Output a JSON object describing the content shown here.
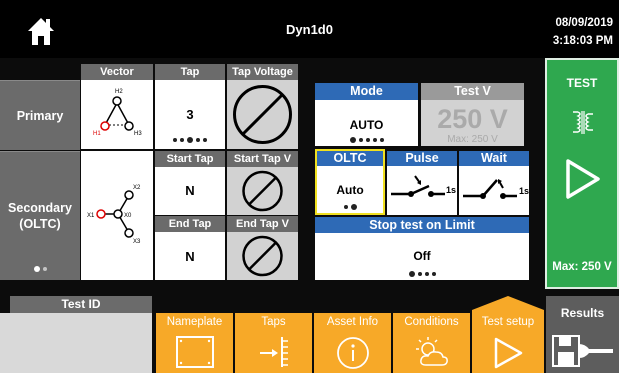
{
  "header": {
    "title": "Dyn1d0",
    "date": "08/09/2019",
    "time": "3:18:03 PM"
  },
  "rows": {
    "primary": "Primary",
    "secondary_line1": "Secondary",
    "secondary_line2": "(OLTC)"
  },
  "columns": {
    "vector": "Vector",
    "tap": "Tap",
    "tap_voltage": "Tap Voltage",
    "start_tap": "Start Tap",
    "start_tap_v": "Start Tap V",
    "end_tap": "End Tap",
    "end_tap_v": "End Tap V"
  },
  "primary": {
    "tap_value": "3",
    "vector_labels": {
      "top": "H2",
      "left": "H1",
      "right": "H3"
    }
  },
  "secondary": {
    "start_tap_value": "N",
    "end_tap_value": "N",
    "vector_labels": {
      "x1": "X1",
      "x0": "X0",
      "x2": "X2",
      "x3": "X3"
    }
  },
  "mode": {
    "label": "Mode",
    "value": "AUTO"
  },
  "test_v": {
    "label": "Test V",
    "value": "250 V",
    "max": "Max: 250 V"
  },
  "oltc": {
    "label": "OLTC",
    "value": "Auto"
  },
  "pulse": {
    "label": "Pulse",
    "duration": "1s"
  },
  "wait": {
    "label": "Wait",
    "duration": "1s"
  },
  "stop_on_limit": {
    "label": "Stop test on Limit",
    "value": "Off"
  },
  "test_panel": {
    "label": "TEST",
    "max": "Max: 250 V"
  },
  "bottom": {
    "test_id_label": "Test ID",
    "tabs": [
      "Nameplate",
      "Taps",
      "Asset Info",
      "Conditions",
      "Test setup"
    ],
    "results_label": "Results"
  },
  "colors": {
    "accent_blue": "#2e6ab6",
    "test_green": "#2fa84f",
    "tab_orange": "#f7a928",
    "highlight_yellow": "#f0e020"
  },
  "icons": [
    "home-icon",
    "transformer-icon",
    "play-icon",
    "nameplate-icon",
    "taps-icon",
    "info-icon",
    "conditions-icon",
    "play-icon",
    "results-icon"
  ]
}
